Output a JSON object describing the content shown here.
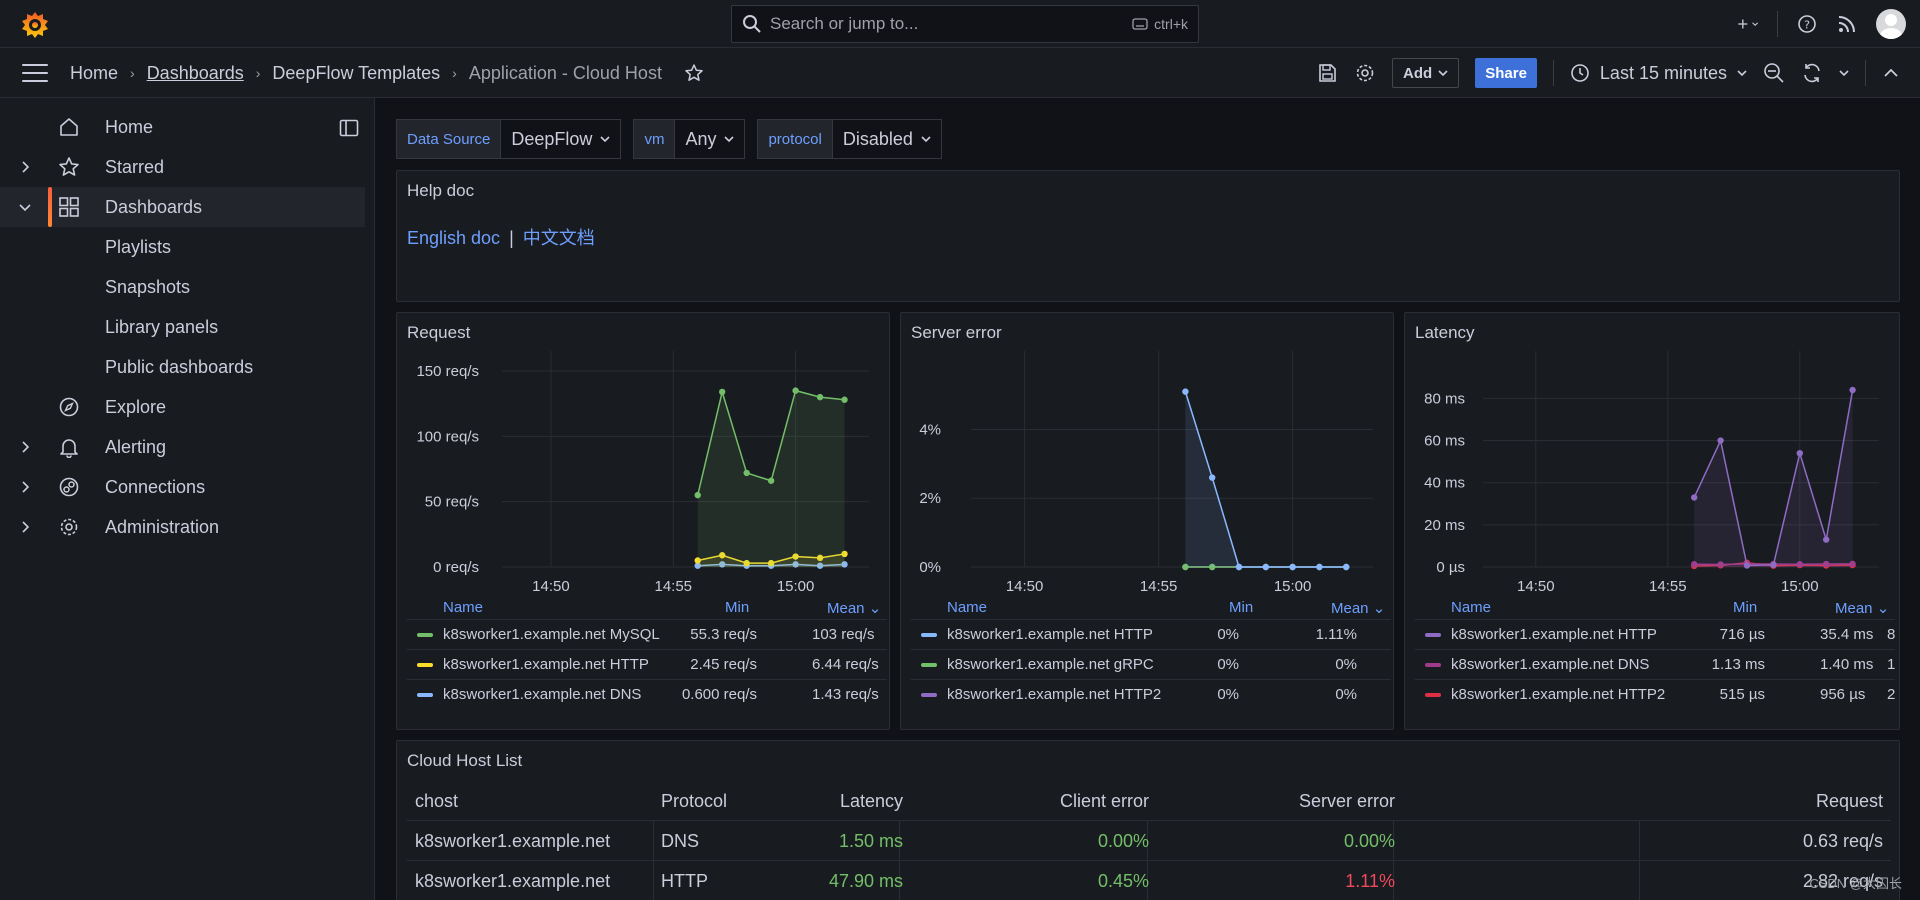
{
  "topbar": {
    "search_placeholder": "Search or jump to...",
    "shortcut": "ctrl+k"
  },
  "breadcrumb": {
    "home": "Home",
    "dashboards": "Dashboards",
    "folder": "DeepFlow Templates",
    "current": "Application - Cloud Host"
  },
  "actions": {
    "add": "Add",
    "share": "Share",
    "time_range": "Last 15 minutes"
  },
  "sidebar": {
    "items": [
      {
        "label": "Home",
        "icon": "home-icon",
        "expand": false
      },
      {
        "label": "Starred",
        "icon": "star-icon",
        "expand": true
      },
      {
        "label": "Dashboards",
        "icon": "dashboards-icon",
        "expand": true,
        "active": true
      },
      {
        "label": "Playlists"
      },
      {
        "label": "Snapshots"
      },
      {
        "label": "Library panels"
      },
      {
        "label": "Public dashboards"
      },
      {
        "label": "Explore",
        "icon": "compass-icon",
        "expand": false
      },
      {
        "label": "Alerting",
        "icon": "bell-icon",
        "expand": true
      },
      {
        "label": "Connections",
        "icon": "connections-icon",
        "expand": true
      },
      {
        "label": "Administration",
        "icon": "gear-icon",
        "expand": true
      }
    ]
  },
  "variables": [
    {
      "label": "Data Source",
      "value": "DeepFlow"
    },
    {
      "label": "vm",
      "value": "Any"
    },
    {
      "label": "protocol",
      "value": "Disabled"
    }
  ],
  "help": {
    "title": "Help doc",
    "link_en": "English doc",
    "separator": "|",
    "link_cn": "中文文档"
  },
  "colors": {
    "green": "#73bf69",
    "yellow": "#fade2a",
    "blue": "#8ab8ff",
    "red": "#f2495c",
    "purple": "#8f6cc4",
    "darkred": "#c4162a",
    "lightblue": "#8ab8ff",
    "magenta": "#a13a8a"
  },
  "chart_data": [
    {
      "type": "line",
      "title": "Request",
      "x": [
        "14:56",
        "14:57",
        "14:58",
        "14:59",
        "15:00",
        "15:01",
        "15:02"
      ],
      "x_ticks": [
        "14:50",
        "14:55",
        "15:00"
      ],
      "y_ticks": [
        "0 req/s",
        "50 req/s",
        "100 req/s",
        "150 req/s"
      ],
      "ylim": [
        0,
        150
      ],
      "series": [
        {
          "name": "k8sworker1.example.net MySQL",
          "color": "#73bf69",
          "values": [
            55,
            134,
            72,
            66,
            135,
            130,
            128
          ],
          "min": "55.3 req/s",
          "mean": "103 req/s"
        },
        {
          "name": "k8sworker1.example.net HTTP",
          "color": "#fade2a",
          "values": [
            5,
            9,
            3,
            3,
            8,
            7,
            10
          ],
          "min": "2.45 req/s",
          "mean": "6.44 req/s"
        },
        {
          "name": "k8sworker1.example.net DNS",
          "color": "#8ab8ff",
          "values": [
            1,
            2,
            1,
            1,
            2,
            1,
            2
          ],
          "min": "0.600 req/s",
          "mean": "1.43 req/s"
        }
      ],
      "legend_headers": {
        "name": "Name",
        "min": "Min",
        "mean": "Mean"
      }
    },
    {
      "type": "line",
      "title": "Server error",
      "x": [
        "14:56",
        "14:57",
        "14:58",
        "14:59",
        "15:00",
        "15:01",
        "15:02"
      ],
      "x_ticks": [
        "14:50",
        "14:55",
        "15:00"
      ],
      "y_ticks": [
        "0%",
        "2%",
        "4%"
      ],
      "ylim": [
        0,
        5.7
      ],
      "series": [
        {
          "name": "k8sworker1.example.net HTTP",
          "color": "#8ab8ff",
          "values": [
            5.1,
            2.6,
            0,
            0,
            0,
            0,
            0
          ],
          "min": "0%",
          "mean": "1.11%"
        },
        {
          "name": "k8sworker1.example.net gRPC",
          "color": "#73bf69",
          "values": [
            0,
            0,
            0,
            0,
            0,
            0,
            0
          ],
          "min": "0%",
          "mean": "0%"
        },
        {
          "name": "k8sworker1.example.net HTTP2",
          "color": "#8f6cc4",
          "values": [
            0,
            0,
            0,
            0,
            0,
            0,
            0
          ],
          "min": "0%",
          "mean": "0%"
        }
      ],
      "legend_headers": {
        "name": "Name",
        "min": "Min",
        "mean": "Mean"
      }
    },
    {
      "type": "line",
      "title": "Latency",
      "x": [
        "14:56",
        "14:57",
        "14:58",
        "14:59",
        "15:00",
        "15:01",
        "15:02"
      ],
      "x_ticks": [
        "14:50",
        "14:55",
        "15:00"
      ],
      "y_ticks": [
        "0 µs",
        "20 ms",
        "40 ms",
        "60 ms",
        "80 ms"
      ],
      "ylim": [
        0,
        93
      ],
      "series": [
        {
          "name": "k8sworker1.example.net HTTP",
          "color": "#8f6cc4",
          "values": [
            33,
            60,
            0.7,
            1,
            54,
            13,
            84
          ],
          "min": "716 µs",
          "mean": "35.4 ms",
          "extra": "8"
        },
        {
          "name": "k8sworker1.example.net DNS",
          "color": "#a13a8a",
          "values": [
            1.3,
            1.2,
            1.5,
            1.4,
            1.3,
            1.4,
            1.5
          ],
          "min": "1.13 ms",
          "mean": "1.40 ms",
          "extra": "1"
        },
        {
          "name": "k8sworker1.example.net HTTP2",
          "color": "#e02f44",
          "values": [
            0.5,
            0.8,
            2,
            0.6,
            0.9,
            0.7,
            0.9
          ],
          "min": "515 µs",
          "mean": "956 µs",
          "extra": "2"
        }
      ],
      "legend_headers": {
        "name": "Name",
        "min": "Min",
        "mean": "Mean"
      }
    }
  ],
  "table": {
    "title": "Cloud Host List",
    "headers": [
      "chost",
      "Protocol",
      "Latency",
      "Client error",
      "Server error",
      "Request"
    ],
    "rows": [
      {
        "chost": "k8sworker1.example.net",
        "protocol": "DNS",
        "latency": "1.50 ms",
        "client_error": "0.00%",
        "server_error": "0.00%",
        "request": "0.63 req/s"
      },
      {
        "chost": "k8sworker1.example.net",
        "protocol": "HTTP",
        "latency": "47.90 ms",
        "client_error": "0.45%",
        "server_error": "1.11%",
        "request": "2.82 req/s"
      }
    ]
  },
  "watermark": "CSDN @大囚长"
}
